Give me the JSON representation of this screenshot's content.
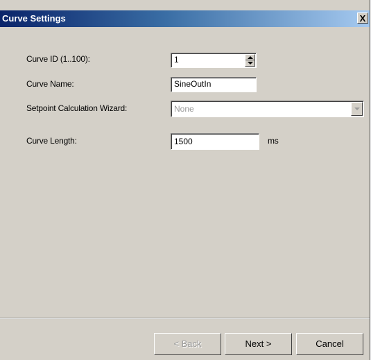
{
  "window": {
    "title": "Curve Settings",
    "close_label": "X"
  },
  "form": {
    "curve_id": {
      "label": "Curve ID (1..100):",
      "value": "1"
    },
    "curve_name": {
      "label": "Curve Name:",
      "value": "SineOutIn"
    },
    "setpoint_wizard": {
      "label": "Setpoint Calculation Wizard:",
      "value": "None"
    },
    "curve_length": {
      "label": "Curve Length:",
      "value": "1500",
      "unit": "ms"
    }
  },
  "buttons": {
    "back": "< Back",
    "next": "Next >",
    "cancel": "Cancel"
  }
}
